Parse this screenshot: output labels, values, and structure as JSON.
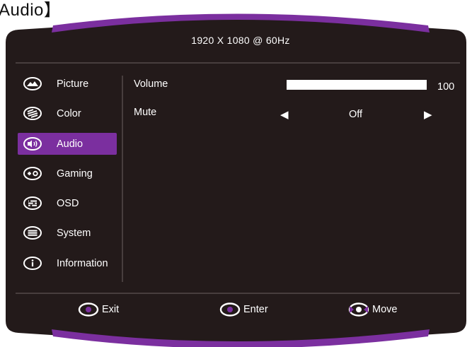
{
  "caption": "Audio】",
  "header": {
    "resolution": "1920  X  1080  @  60Hz"
  },
  "sidebar": {
    "items": [
      {
        "label": "Picture",
        "icon": "picture-icon",
        "active": false
      },
      {
        "label": "Color",
        "icon": "color-icon",
        "active": false
      },
      {
        "label": "Audio",
        "icon": "audio-icon",
        "active": true
      },
      {
        "label": "Gaming",
        "icon": "gaming-icon",
        "active": false
      },
      {
        "label": "OSD",
        "icon": "osd-icon",
        "active": false
      },
      {
        "label": "System",
        "icon": "system-icon",
        "active": false
      },
      {
        "label": "Information",
        "icon": "information-icon",
        "active": false
      }
    ]
  },
  "main": {
    "volume": {
      "label": "Volume",
      "value": "100",
      "level": 1.0
    },
    "mute": {
      "label": "Mute",
      "value": "Off"
    }
  },
  "footer": {
    "exit_label": "Exit",
    "enter_label": "Enter",
    "move_label": "Move"
  },
  "colors": {
    "accent": "#7b2f9f",
    "panel": "#231a1a",
    "text": "#ffffff"
  }
}
